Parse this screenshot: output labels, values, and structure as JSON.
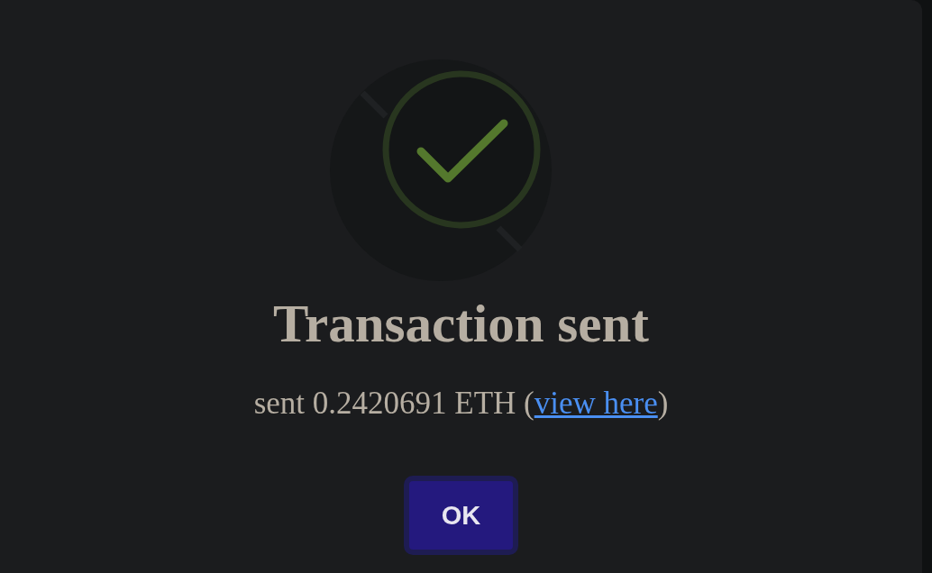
{
  "dialog": {
    "title": "Transaction sent",
    "message": {
      "text": "sent 0.2420691 ETH (",
      "link": "view here",
      "text_after": ")"
    },
    "buttons": [
      {
        "label": "OK"
      }
    ]
  }
}
